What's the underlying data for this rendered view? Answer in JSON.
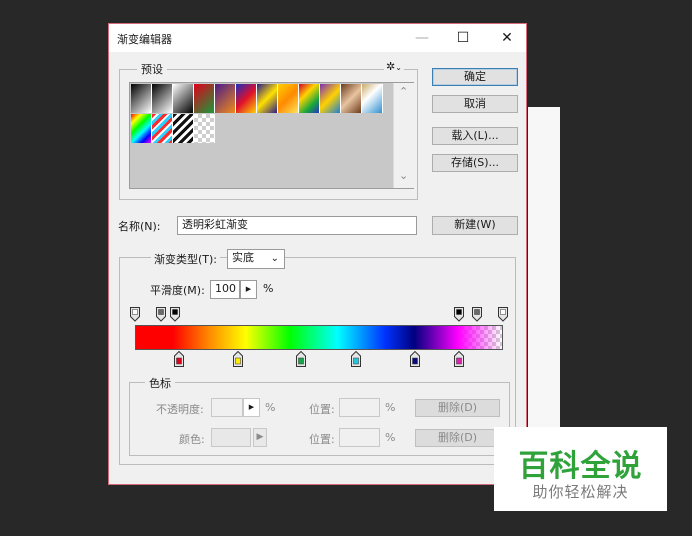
{
  "dialog": {
    "title": "渐变编辑器",
    "minimize_icon": "—",
    "maximize_icon": "☐",
    "close_icon": "✕"
  },
  "presets": {
    "legend": "预设",
    "gear_icon": "✲",
    "swatches": [
      {
        "type": "gradient",
        "bg": "linear-gradient(135deg,#000 0%,#fff 100%)"
      },
      {
        "type": "gradient",
        "bg": "linear-gradient(135deg,#000 0%,rgba(0,0,0,0) 100%)"
      },
      {
        "type": "gradient",
        "bg": "linear-gradient(135deg,#fff 0%,#000 100%)"
      },
      {
        "type": "gradient",
        "bg": "linear-gradient(135deg,#e0001b 0%,#1a9a3a 100%)"
      },
      {
        "type": "gradient",
        "bg": "linear-gradient(135deg,#4b1b8a 0%,#f08b1a 100%)"
      },
      {
        "type": "gradient",
        "bg": "linear-gradient(135deg,#1b2fbf 0%,#e0102a 50%,#ffd200 100%)"
      },
      {
        "type": "gradient",
        "bg": "linear-gradient(135deg,#2a1b8a 0%,#ffe100 50%,#2a1b8a 100%)"
      },
      {
        "type": "gradient",
        "bg": "linear-gradient(135deg,#ffd000 0%,#ff8a00 50%,#ffe45a 100%)"
      },
      {
        "type": "gradient",
        "bg": "linear-gradient(135deg,#d4002a 0%,#ffd400 35%,#18a83a 70%,#2134c6 100%)"
      },
      {
        "type": "gradient",
        "bg": "linear-gradient(135deg,#7b2dbb 0%,#ffd200 50%,#1a7fd4 100%)"
      },
      {
        "type": "gradient",
        "bg": "linear-gradient(135deg,#6b3b1b 0%,#e8c4a0 50%,#6b3b1b 100%)"
      },
      {
        "type": "gradient",
        "bg": "linear-gradient(135deg,#c9a866 0%,#fff 40%,#2f8fd0 100%)"
      },
      {
        "type": "gradient",
        "bg": "linear-gradient(135deg,#ff0000,#ffff00,#00ff00,#00ffff,#0000ff,#ff00ff)"
      },
      {
        "type": "gradient",
        "bg": "repeating-linear-gradient(135deg,#ff2a2a 0 3px,#fff 3px 5px,#2ad0ff 5px 8px)"
      },
      {
        "type": "gradient",
        "bg": "repeating-linear-gradient(135deg,#111 0 3px,#fff 3px 6px)"
      },
      {
        "type": "checker",
        "bg": ""
      }
    ],
    "scroll_up": "⌃",
    "scroll_down": "⌄"
  },
  "buttons": {
    "ok": "确定",
    "cancel": "取消",
    "load": "载入(L)...",
    "save": "存储(S)...",
    "new": "新建(W)"
  },
  "name": {
    "label": "名称(N):",
    "value": "透明彩虹渐变"
  },
  "gradient": {
    "type_label": "渐变类型(T):",
    "type_value": "实底",
    "smoothness_label": "平滑度(M):",
    "smoothness_value": "100",
    "smoothness_unit": "%",
    "bar_bg": "linear-gradient(90deg,#ff0000 10%,#ff8a00 20%,#ffff00 30%,#00ff00 42%,#00ffff 55%,#0033ff 68%,#000080 76%,#ff00ff 88%,rgba(255,0,255,0) 100%)",
    "color_stops": [
      {
        "color": "#e0001b",
        "pos": 0.12
      },
      {
        "color": "#ffee00",
        "pos": 0.28
      },
      {
        "color": "#13a84a",
        "pos": 0.45
      },
      {
        "color": "#20c8e0",
        "pos": 0.6
      },
      {
        "color": "#0a0a80",
        "pos": 0.76
      },
      {
        "color": "#e020b0",
        "pos": 0.88
      }
    ],
    "opacity_stops": [
      {
        "fill": "#ffffff",
        "pos": 0.0
      },
      {
        "fill": "#6a6a6a",
        "pos": 0.07
      },
      {
        "fill": "#000000",
        "pos": 0.11
      },
      {
        "fill": "#000000",
        "pos": 0.88
      },
      {
        "fill": "#6a6a6a",
        "pos": 0.93
      },
      {
        "fill": "#ffffff",
        "pos": 1.0
      }
    ]
  },
  "color_stop_group": {
    "legend": "色标",
    "opacity_label": "不透明度:",
    "opacity_unit": "%",
    "position_label_1": "位置:",
    "position_unit_1": "%",
    "delete_1": "删除(D)",
    "color_label": "颜色:",
    "position_label_2": "位置:",
    "position_unit_2": "%",
    "delete_2": "删除(D)"
  },
  "watermark": {
    "title": "百科全说",
    "subtitle": "助你轻松解决"
  }
}
